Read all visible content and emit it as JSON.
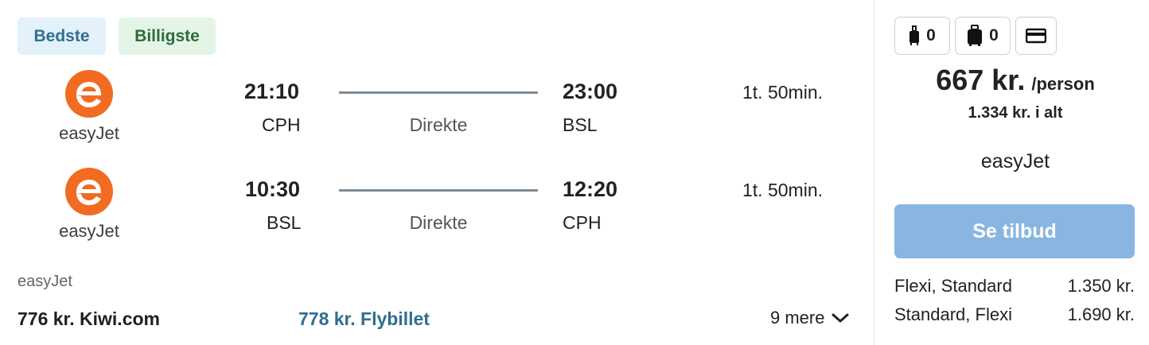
{
  "badges": {
    "best": "Bedste",
    "cheapest": "Billigste"
  },
  "colors": {
    "easyjet_orange": "#f26b22",
    "badge_best_bg": "#e3f1fb",
    "badge_cheap_bg": "#e4f5e7",
    "cta_bg": "#88b6e1",
    "link_blue": "#2f6e8e"
  },
  "legs": [
    {
      "airline": "easyJet",
      "dep_time": "21:10",
      "dep_code": "CPH",
      "stops": "Direkte",
      "arr_time": "23:00",
      "arr_code": "BSL",
      "duration": "1t. 50min."
    },
    {
      "airline": "easyJet",
      "dep_time": "10:30",
      "dep_code": "BSL",
      "stops": "Direkte",
      "arr_time": "12:20",
      "arr_code": "CPH",
      "duration": "1t. 50min."
    }
  ],
  "operator": "easyJet",
  "deals": [
    {
      "label": "776 kr. Kiwi.com"
    },
    {
      "label": "778 kr. Flybillet"
    }
  ],
  "more": {
    "label": "9 mere"
  },
  "side": {
    "bags": {
      "cabin_count": "0",
      "checked_count": "0",
      "icons": [
        "cabin-bag-icon",
        "checked-bag-icon",
        "credit-card-icon"
      ]
    },
    "price": "667 kr.",
    "per_person": "/person",
    "total": "1.334 kr. i alt",
    "airline": "easyJet",
    "cta": "Se tilbud",
    "fares": [
      {
        "name": "Flexi, Standard",
        "price": "1.350 kr."
      },
      {
        "name": "Standard, Flexi",
        "price": "1.690 kr."
      }
    ]
  }
}
